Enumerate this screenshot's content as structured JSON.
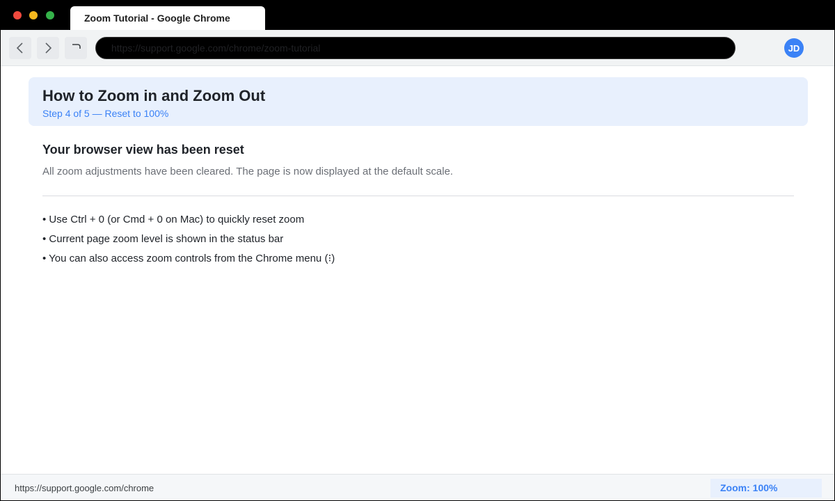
{
  "window": {
    "title": "Zoom Tutorial - Google Chrome"
  },
  "toolbar": {
    "url": "https://support.google.com/chrome/zoom-tutorial",
    "avatar_initials": "JD",
    "icons": {
      "back": "chevron-left-icon",
      "forward": "chevron-right-icon",
      "reload": "reload-icon"
    }
  },
  "colors": {
    "accent": "#3b82f6",
    "banner_bg": "#e8f0fd",
    "close": "#f04a3e",
    "minimize": "#f5b81e",
    "maximize": "#35b24a"
  },
  "tutorial": {
    "title": "How to Zoom in and Zoom Out",
    "step": "Step 4 of 5 — Reset to 100%",
    "heading": "Your browser view has been reset",
    "description": "All zoom adjustments have been cleared. The page is now displayed at the default scale.",
    "tips": [
      "• Use Ctrl + 0 (or Cmd + 0 on Mac) to quickly reset zoom",
      "• Current page zoom level is shown in the status bar",
      "• You can also access zoom controls from the Chrome menu (⁝)"
    ]
  },
  "statusbar": {
    "url": "https://support.google.com/chrome",
    "zoom": "Zoom: 100%"
  }
}
